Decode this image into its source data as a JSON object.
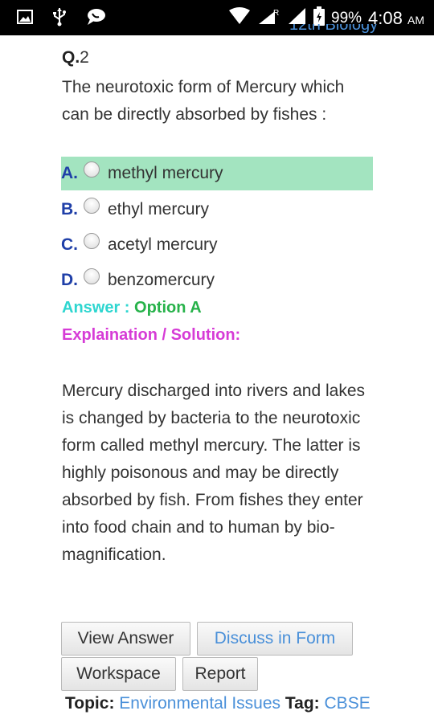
{
  "status_bar": {
    "battery": "99%",
    "time": "4:08",
    "ampm": "AM"
  },
  "header": {
    "subject_clipped": "12th Biology"
  },
  "question": {
    "prefix": "Q.",
    "number": "2",
    "text": "The neurotoxic form of Mercury which can be directly absorbed by fishes :"
  },
  "options": [
    {
      "letter": "A.",
      "text": "methyl mercury",
      "selected": true
    },
    {
      "letter": "B.",
      "text": "ethyl mercury",
      "selected": false
    },
    {
      "letter": "C.",
      "text": "acetyl mercury",
      "selected": false
    },
    {
      "letter": "D.",
      "text": "benzomercury",
      "selected": false
    }
  ],
  "answer": {
    "label": "Answer : ",
    "value": "Option A"
  },
  "explanation": {
    "label": "Explaination / Solution:",
    "text": "Mercury discharged into rivers and lakes is changed by bacteria to the neurotoxic form called methyl mercury. The latter is highly poisonous and may be directly absorbed by fish. From fishes they enter into food chain and to human by bio-magnification."
  },
  "buttons": {
    "view_answer": "View Answer",
    "discuss": "Discuss in Form",
    "workspace": "Workspace",
    "report": "Report"
  },
  "footer": {
    "topic_label": "Topic:",
    "topic_value": "Environmental Issues",
    "tag_label": "Tag:",
    "tag_value": "CBSE"
  },
  "colors": {
    "status_bar_bg": "#000000",
    "selected_option_bg": "#a3e4c0",
    "option_letter": "#1f3fa8",
    "answer_label": "#2ed6d0",
    "answer_value": "#27b24a",
    "explanation_label": "#d63bd6",
    "link": "#4a90d9"
  }
}
